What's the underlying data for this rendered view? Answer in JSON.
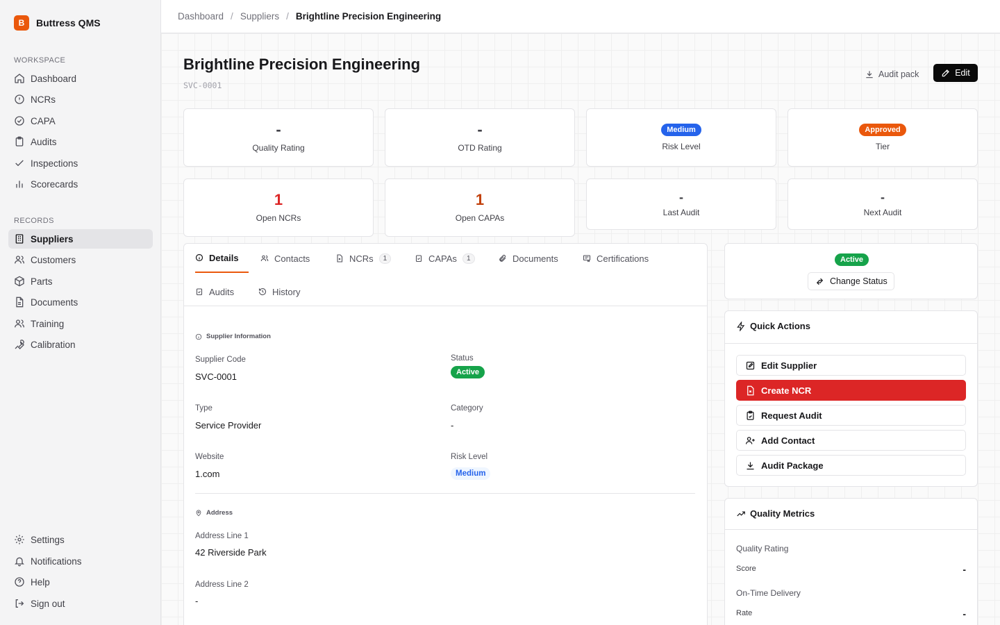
{
  "app": {
    "name": "Buttress QMS",
    "logo_letter": "B"
  },
  "sidebar": {
    "workspace_label": "WORKSPACE",
    "records_label": "RECORDS",
    "workspace_items": [
      {
        "label": "Dashboard",
        "icon": "home-icon"
      },
      {
        "label": "NCRs",
        "icon": "alert-circle-icon"
      },
      {
        "label": "CAPA",
        "icon": "check-circle-icon"
      },
      {
        "label": "Audits",
        "icon": "clipboard-icon"
      },
      {
        "label": "Inspections",
        "icon": "check-icon"
      },
      {
        "label": "Scorecards",
        "icon": "bar-chart-icon"
      }
    ],
    "records_items": [
      {
        "label": "Suppliers",
        "icon": "building-icon",
        "active": true
      },
      {
        "label": "Customers",
        "icon": "users-icon"
      },
      {
        "label": "Parts",
        "icon": "package-icon"
      },
      {
        "label": "Documents",
        "icon": "file-icon"
      },
      {
        "label": "Training",
        "icon": "users-icon"
      },
      {
        "label": "Calibration",
        "icon": "wrench-icon"
      }
    ],
    "bottom_items": [
      {
        "label": "Settings",
        "icon": "gear-icon"
      },
      {
        "label": "Notifications",
        "icon": "bell-icon"
      },
      {
        "label": "Help",
        "icon": "help-icon"
      },
      {
        "label": "Sign out",
        "icon": "logout-icon"
      }
    ]
  },
  "breadcrumb": {
    "items": [
      "Dashboard",
      "Suppliers"
    ],
    "current": "Brightline Precision Engineering"
  },
  "header": {
    "title": "Brightline Precision Engineering",
    "code": "SVC-0001",
    "audit_pack_label": "Audit pack",
    "edit_label": "Edit"
  },
  "stats": {
    "quality_rating": {
      "value": "-",
      "label": "Quality Rating"
    },
    "otd_rating": {
      "value": "-",
      "label": "OTD Rating"
    },
    "risk_level": {
      "value": "Medium",
      "label": "Risk Level",
      "color": "#2563eb"
    },
    "tier": {
      "value": "Approved",
      "label": "Tier",
      "color": "#ea580c"
    },
    "open_ncrs": {
      "value": "1",
      "label": "Open NCRs",
      "color": "#dc2626"
    },
    "open_capas": {
      "value": "1",
      "label": "Open CAPAs",
      "color": "#c2410c"
    },
    "last_audit": {
      "value": "-",
      "label": "Last Audit"
    },
    "next_audit": {
      "value": "-",
      "label": "Next Audit"
    }
  },
  "tabs": [
    {
      "label": "Details",
      "active": true
    },
    {
      "label": "Contacts"
    },
    {
      "label": "NCRs",
      "count": "1"
    },
    {
      "label": "CAPAs",
      "count": "1"
    },
    {
      "label": "Documents"
    },
    {
      "label": "Certifications"
    },
    {
      "label": "Audits"
    },
    {
      "label": "History"
    }
  ],
  "details": {
    "supplier_info_heading": "Supplier Information",
    "address_heading": "Address",
    "fields": {
      "supplier_code": {
        "label": "Supplier Code",
        "value": "SVC-0001"
      },
      "status": {
        "label": "Status",
        "value": "Active"
      },
      "type": {
        "label": "Type",
        "value": "Service Provider"
      },
      "category": {
        "label": "Category",
        "value": "-"
      },
      "website": {
        "label": "Website",
        "value": "1.com"
      },
      "risk_level": {
        "label": "Risk Level",
        "value": "Medium"
      },
      "address_line_1": {
        "label": "Address Line 1",
        "value": "42 Riverside Park"
      },
      "address_line_2": {
        "label": "Address Line 2",
        "value": "-"
      }
    }
  },
  "status_panel": {
    "status": "Active",
    "change_status_label": "Change Status"
  },
  "quick_actions": {
    "title": "Quick Actions",
    "items": [
      {
        "label": "Edit Supplier"
      },
      {
        "label": "Create NCR"
      },
      {
        "label": "Request Audit"
      },
      {
        "label": "Add Contact"
      },
      {
        "label": "Audit Package"
      }
    ]
  },
  "quality_metrics": {
    "title": "Quality Metrics",
    "quality_rating_label": "Quality Rating",
    "score_label": "Score",
    "score_value": "-",
    "otd_label": "On-Time Delivery",
    "rate_label": "Rate",
    "rate_value": "-"
  },
  "colors": {
    "accent": "#ea580c",
    "active_green": "#16a34a",
    "danger": "#dc2626",
    "info_blue": "#2563eb"
  }
}
